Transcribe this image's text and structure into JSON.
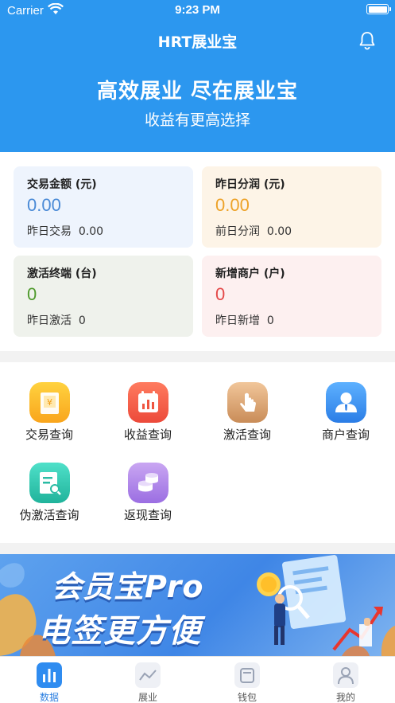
{
  "status_bar": {
    "carrier": "Carrier",
    "time": "9:23 PM"
  },
  "nav": {
    "title": "HRT展业宝",
    "bell_icon": "bell-icon"
  },
  "hero": {
    "title": "高效展业 尽在展业宝",
    "subtitle": "收益有更高选择"
  },
  "stats": [
    {
      "label": "交易金额 (元)",
      "value": "0.00",
      "sub_label": "昨日交易",
      "sub_value": "0.00",
      "color": "#4a8ad6"
    },
    {
      "label": "昨日分润 (元)",
      "value": "0.00",
      "sub_label": "前日分润",
      "sub_value": "0.00",
      "color": "#eda228"
    },
    {
      "label": "激活终端 (台)",
      "value": "0",
      "sub_label": "昨日激活",
      "sub_value": "0",
      "color": "#4f9a2c"
    },
    {
      "label": "新增商户 (户)",
      "value": "0",
      "sub_label": "昨日新增",
      "sub_value": "0",
      "color": "#e44848"
    }
  ],
  "menu": [
    {
      "label": "交易查询",
      "icon": "transaction-query-icon"
    },
    {
      "label": "收益查询",
      "icon": "income-query-icon"
    },
    {
      "label": "激活查询",
      "icon": "activation-query-icon"
    },
    {
      "label": "商户查询",
      "icon": "merchant-query-icon"
    },
    {
      "label": "伪激活查询",
      "icon": "fake-activation-query-icon"
    },
    {
      "label": "返现查询",
      "icon": "cashback-query-icon"
    }
  ],
  "banner": {
    "line1": "会员宝Pro",
    "line2": "电签更方便"
  },
  "tabs": [
    {
      "label": "数据",
      "icon": "data-chart-icon",
      "active": true
    },
    {
      "label": "展业",
      "icon": "trend-line-icon",
      "active": false
    },
    {
      "label": "钱包",
      "icon": "wallet-icon",
      "active": false
    },
    {
      "label": "我的",
      "icon": "profile-icon",
      "active": false
    }
  ],
  "colors": {
    "primary": "#2c97ef",
    "tab_active": "#2c7fe0"
  }
}
